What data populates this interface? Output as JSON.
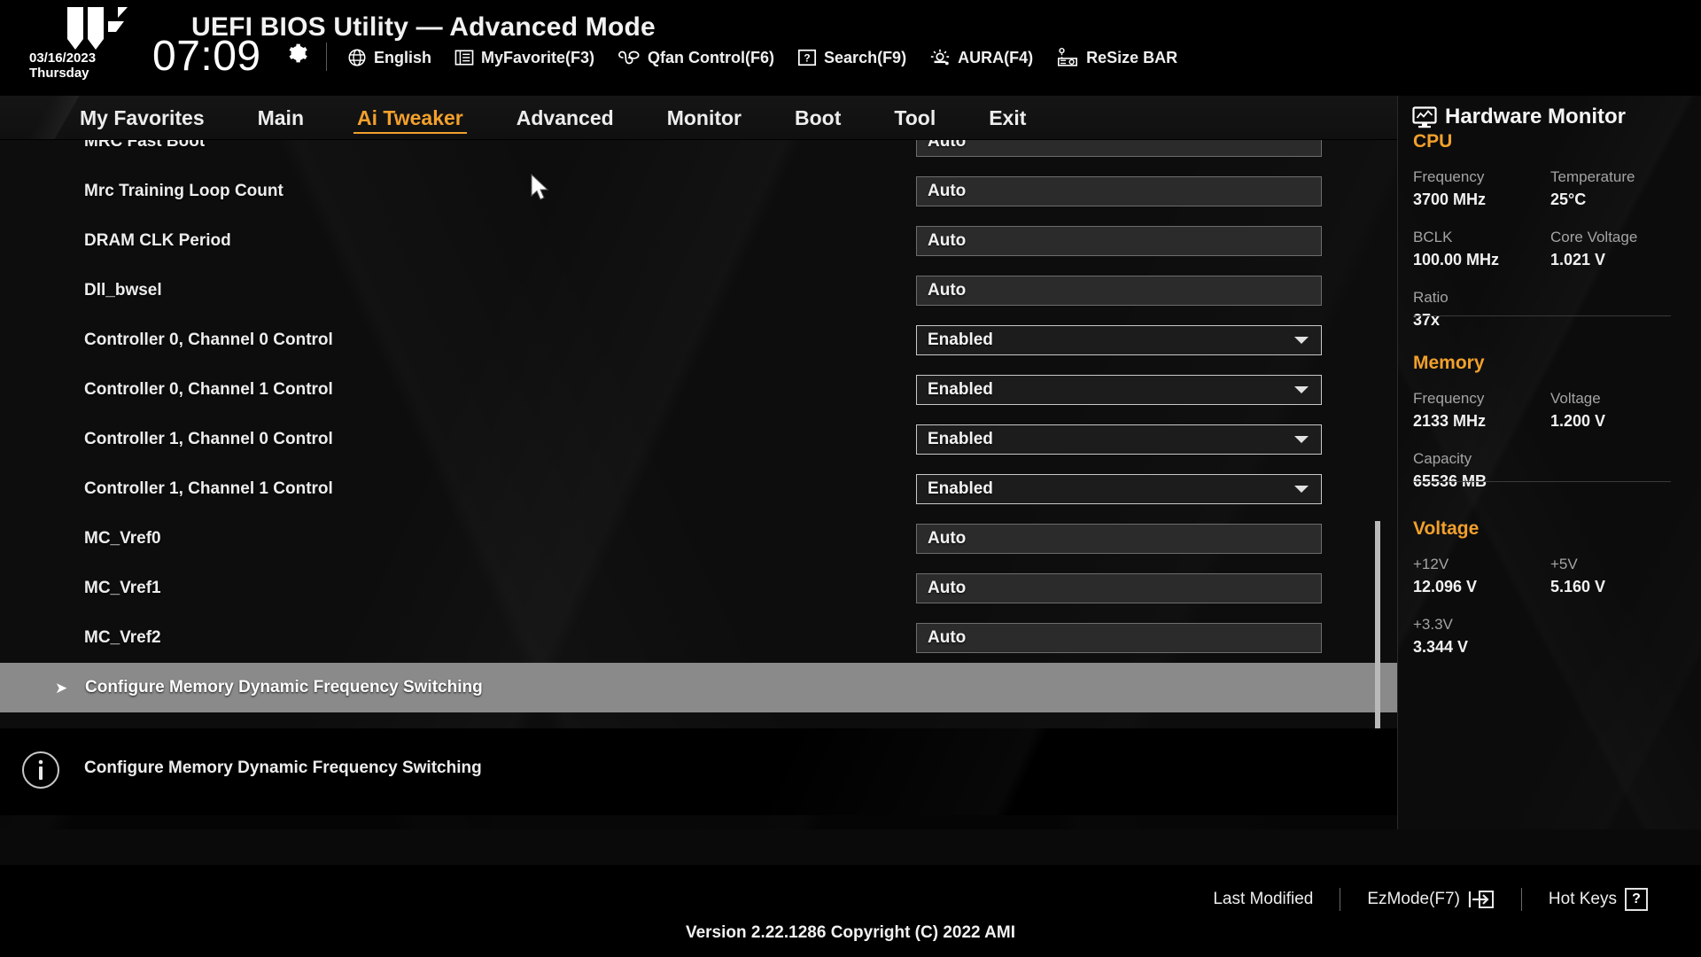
{
  "header": {
    "title": "UEFI BIOS Utility — Advanced Mode",
    "date": "03/16/2023",
    "weekday": "Thursday",
    "time": "07:09",
    "gear_icon": "gear-icon",
    "tools": [
      {
        "label": "English",
        "icon": "globe-icon"
      },
      {
        "label": "MyFavorite(F3)",
        "icon": "favorites-icon"
      },
      {
        "label": "Qfan Control(F6)",
        "icon": "fan-icon"
      },
      {
        "label": "Search(F9)",
        "icon": "question-box-icon"
      },
      {
        "label": "AURA(F4)",
        "icon": "aura-light-icon"
      },
      {
        "label": "ReSize BAR",
        "icon": "gpu-card-icon"
      }
    ]
  },
  "nav": {
    "tabs": [
      {
        "label": "My Favorites",
        "active": false
      },
      {
        "label": "Main",
        "active": false
      },
      {
        "label": "Ai Tweaker",
        "active": true
      },
      {
        "label": "Advanced",
        "active": false
      },
      {
        "label": "Monitor",
        "active": false
      },
      {
        "label": "Boot",
        "active": false
      },
      {
        "label": "Tool",
        "active": false
      },
      {
        "label": "Exit",
        "active": false
      }
    ],
    "active_color": "#f2a02c"
  },
  "settings": {
    "rows": [
      {
        "label": "MRC Fast Boot",
        "value": "Auto",
        "type": "input",
        "clipped": true
      },
      {
        "label": "Mrc Training Loop Count",
        "value": "Auto",
        "type": "input"
      },
      {
        "label": "DRAM CLK Period",
        "value": "Auto",
        "type": "input"
      },
      {
        "label": "Dll_bwsel",
        "value": "Auto",
        "type": "input"
      },
      {
        "label": "Controller 0, Channel 0 Control",
        "value": "Enabled",
        "type": "select"
      },
      {
        "label": "Controller 0, Channel 1 Control",
        "value": "Enabled",
        "type": "select"
      },
      {
        "label": "Controller 1, Channel 0 Control",
        "value": "Enabled",
        "type": "select"
      },
      {
        "label": "Controller 1, Channel 1 Control",
        "value": "Enabled",
        "type": "select"
      },
      {
        "label": "MC_Vref0",
        "value": "Auto",
        "type": "input"
      },
      {
        "label": "MC_Vref1",
        "value": "Auto",
        "type": "input"
      },
      {
        "label": "MC_Vref2",
        "value": "Auto",
        "type": "input"
      }
    ],
    "submenu": {
      "label": "Configure Memory Dynamic Frequency Switching",
      "arrow": "➤"
    }
  },
  "info": {
    "icon": "info-circle-icon",
    "text": "Configure Memory Dynamic Frequency Switching"
  },
  "hardware_monitor": {
    "title": "Hardware Monitor",
    "icon": "monitor-graph-icon",
    "accent_color": "#f2a02c",
    "sections": [
      {
        "name": "CPU",
        "items": [
          {
            "key": "Frequency",
            "value": "3700 MHz"
          },
          {
            "key": "Temperature",
            "value": "25°C"
          },
          {
            "key": "BCLK",
            "value": "100.00 MHz"
          },
          {
            "key": "Core Voltage",
            "value": "1.021 V"
          },
          {
            "key": "Ratio",
            "value": "37x"
          }
        ]
      },
      {
        "name": "Memory",
        "items": [
          {
            "key": "Frequency",
            "value": "2133 MHz"
          },
          {
            "key": "Voltage",
            "value": "1.200 V"
          },
          {
            "key": "Capacity",
            "value": "65536 MB"
          }
        ]
      },
      {
        "name": "Voltage",
        "items": [
          {
            "key": "+12V",
            "value": "12.096 V"
          },
          {
            "key": "+5V",
            "value": "5.160 V"
          },
          {
            "key": "+3.3V",
            "value": "3.344 V"
          }
        ]
      }
    ]
  },
  "footer": {
    "links": [
      {
        "label": "Last Modified",
        "icon": ""
      },
      {
        "label": "EzMode(F7)",
        "icon": "exit-arrow-icon"
      },
      {
        "label": "Hot Keys",
        "icon": "question-box-icon"
      }
    ],
    "version": "Version 2.22.1286 Copyright (C) 2022 AMI"
  }
}
